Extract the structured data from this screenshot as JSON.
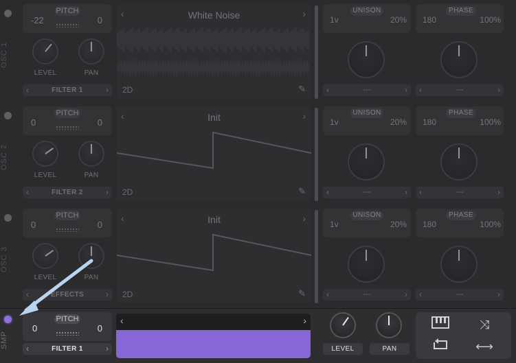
{
  "oscillators": [
    {
      "side_label": "OSC 1",
      "pitch": {
        "label": "PITCH",
        "left": "-22",
        "right": "0"
      },
      "level_label": "LEVEL",
      "pan_label": "PAN",
      "filter": "FILTER 1",
      "wave_title": "White Noise",
      "wave_mode": "2D",
      "unison": {
        "label": "UNISON",
        "voices": "1v",
        "detune": "20%"
      },
      "phase": {
        "label": "PHASE",
        "deg": "180",
        "amount": "100%"
      },
      "unison_sel": "---",
      "phase_sel": "---"
    },
    {
      "side_label": "OSC 2",
      "pitch": {
        "label": "PITCH",
        "left": "0",
        "right": "0"
      },
      "level_label": "LEVEL",
      "pan_label": "PAN",
      "filter": "FILTER 2",
      "wave_title": "Init",
      "wave_mode": "2D",
      "unison": {
        "label": "UNISON",
        "voices": "1v",
        "detune": "20%"
      },
      "phase": {
        "label": "PHASE",
        "deg": "180",
        "amount": "100%"
      },
      "unison_sel": "---",
      "phase_sel": "---"
    },
    {
      "side_label": "OSC 3",
      "pitch": {
        "label": "PITCH",
        "left": "0",
        "right": "0"
      },
      "level_label": "LEVEL",
      "pan_label": "PAN",
      "filter": "EFFECTS",
      "wave_title": "Init",
      "wave_mode": "2D",
      "unison": {
        "label": "UNISON",
        "voices": "1v",
        "detune": "20%"
      },
      "phase": {
        "label": "PHASE",
        "deg": "180",
        "amount": "100%"
      },
      "unison_sel": "---",
      "phase_sel": "---"
    }
  ],
  "sampler": {
    "side_label": "SMP",
    "pitch": {
      "label": "PITCH",
      "left": "0",
      "right": "0"
    },
    "filter": "FILTER 1",
    "level_label": "LEVEL",
    "pan_label": "PAN",
    "controls": [
      "keytrack-icon",
      "random-phase-icon",
      "loop-icon",
      "bounce-icon"
    ]
  },
  "colors": {
    "accent": "#8766d6",
    "annotation_arrow": "#b8d4f0"
  }
}
